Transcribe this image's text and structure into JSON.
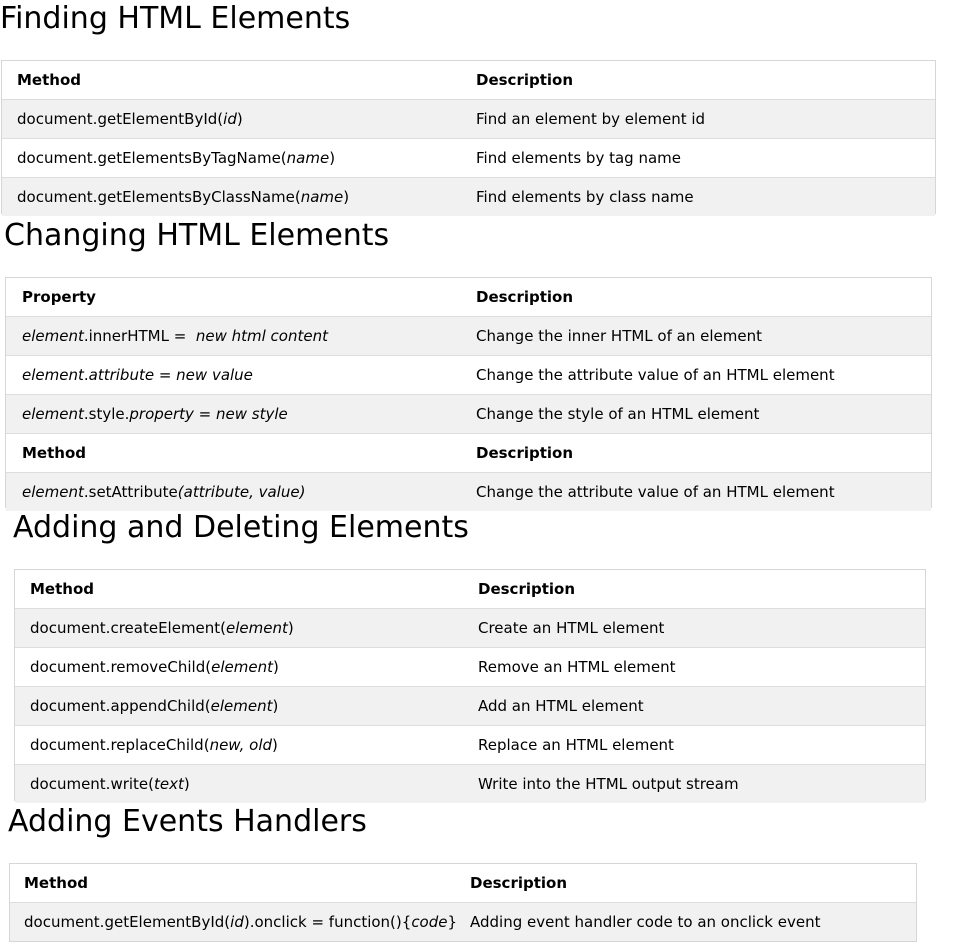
{
  "finding": {
    "title": "Finding HTML Elements",
    "head": {
      "col1": "Method",
      "col2": "Description"
    },
    "rows": [
      {
        "c1_a": "document.getElementById(",
        "c1_i": "id",
        "c1_b": ")",
        "desc": "Find an element by element id"
      },
      {
        "c1_a": "document.getElementsByTagName(",
        "c1_i": "name",
        "c1_b": ")",
        "desc": "Find elements by tag name"
      },
      {
        "c1_a": "document.getElementsByClassName(",
        "c1_i": "name",
        "c1_b": ")",
        "desc": "Find elements by class name"
      }
    ]
  },
  "changing": {
    "title": "Changing HTML Elements",
    "head1": {
      "col1": "Property",
      "col2": "Description"
    },
    "rows1": [
      {
        "i1": "element",
        "n1": ".innerHTML =  ",
        "i2": "new html content",
        "desc": "Change the inner HTML of an element"
      },
      {
        "i1": "element",
        "n1": ".",
        "i2": "attribute = new value",
        "desc": "Change the attribute value of an HTML element"
      },
      {
        "i1": "element",
        "n1": ".style.",
        "i2": "property = new style",
        "desc": "Change the style of an HTML element"
      }
    ],
    "head2": {
      "col1": "Method",
      "col2": "Description"
    },
    "rows2": [
      {
        "i1": "element",
        "n1": ".setAttribute",
        "i2": "(attribute, value)",
        "desc": "Change the attribute value of an HTML element"
      }
    ]
  },
  "adding": {
    "title": "Adding and Deleting Elements",
    "head": {
      "col1": "Method",
      "col2": "Description"
    },
    "rows": [
      {
        "c1_a": "document.createElement(",
        "c1_i": "element",
        "c1_b": ")",
        "desc": "Create an HTML element"
      },
      {
        "c1_a": "document.removeChild(",
        "c1_i": "element",
        "c1_b": ")",
        "desc": "Remove an HTML element"
      },
      {
        "c1_a": "document.appendChild(",
        "c1_i": "element",
        "c1_b": ")",
        "desc": "Add an HTML element"
      },
      {
        "c1_a": "document.replaceChild(",
        "c1_i": "new, old",
        "c1_b": ")",
        "desc": "Replace an HTML element"
      },
      {
        "c1_a": "document.write(",
        "c1_i": "text",
        "c1_b": ")",
        "desc": "Write into the HTML output stream"
      }
    ]
  },
  "events": {
    "title": "Adding Events Handlers",
    "head": {
      "col1": "Method",
      "col2": "Description"
    },
    "rows": [
      {
        "c1_a": "document.getElementById(",
        "c1_i": "id",
        "c1_b": ").onclick = function(){",
        "c1_i2": "code",
        "c1_c": "}",
        "desc": "Adding event handler code to an onclick event"
      }
    ]
  }
}
